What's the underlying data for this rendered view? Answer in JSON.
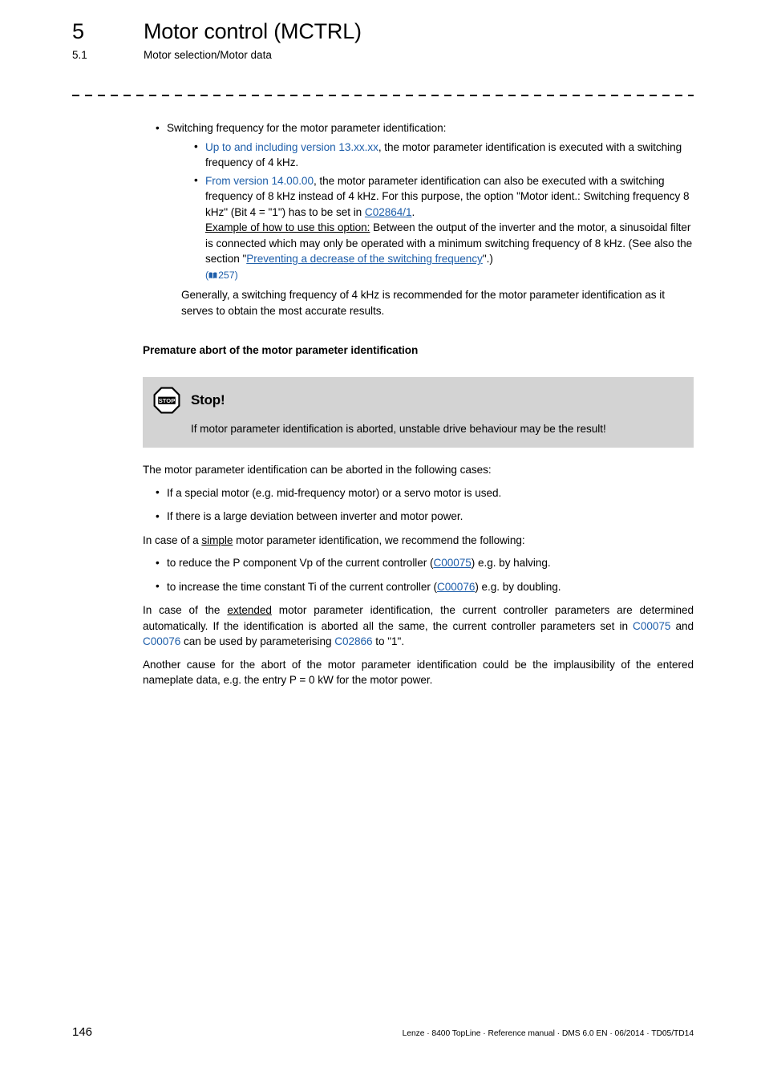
{
  "header": {
    "chapter_number": "5",
    "chapter_title": "Motor control (MCTRL)",
    "section_number": "5.1",
    "section_title": "Motor selection/Motor data"
  },
  "content": {
    "bullet_switching_frequency": "Switching frequency for the motor parameter identification:",
    "sub_bullet_1": {
      "link": "Up to and including version 13.xx.xx",
      "text": ", the motor parameter identification is executed with a switching frequency of 4 kHz."
    },
    "sub_bullet_2": {
      "link": "From version 14.00.00",
      "text_part1": ", the motor parameter identification can also be executed with a switching frequency of 8 kHz instead of 4 kHz. For this purpose, the option \"Motor ident.: Switching frequency 8 kHz\" (Bit 4 = \"1\") has to be set in ",
      "link_c02864": "C02864/1",
      "text_part2": ".",
      "example_label": "Example of how to use this option:",
      "text_part3": " Between the output of the inverter and the motor, a sinusoidal filter is connected which may only be operated with a minimum switching frequency of 8 kHz. (See also the section \"",
      "link_section": "Preventing a decrease of the switching frequency",
      "text_part4": "\".)",
      "page_ref": "257",
      "page_ref_icon": "book-icon"
    },
    "general_note": "Generally, a switching frequency of 4 kHz is recommended for the motor parameter identification as it serves to obtain the most accurate results.",
    "premature_abort_heading": "Premature abort of the motor parameter identification",
    "stop_notice": {
      "icon": "stop-sign-icon",
      "icon_label": "STOP",
      "title": "Stop!",
      "body": "If motor parameter identification is aborted, unstable drive behaviour may be the result!"
    },
    "abort_intro": "The motor parameter identification can be aborted in the following cases:",
    "abort_cases": [
      "If a special motor (e.g. mid-frequency motor) or a servo motor is used.",
      "If there is a large deviation between inverter and motor power."
    ],
    "simple_intro": {
      "text_part1": "In case of a ",
      "emphasis": "simple",
      "text_part2": " motor parameter identification, we recommend the following:"
    },
    "simple_recommendations": [
      {
        "text_part1": "to reduce the P component Vp of the current controller (",
        "link": "C00075",
        "text_part2": ") e.g. by halving."
      },
      {
        "text_part1": "to increase the time constant Ti of the current controller (",
        "link": "C00076",
        "text_part2": ") e.g. by doubling."
      }
    ],
    "extended_para": {
      "text_part1": "In case of the ",
      "emphasis": "extended",
      "text_part2": " motor parameter identification, the current controller parameters are determined automatically. If the identification is aborted all the same, the current controller parameters set in ",
      "link1": "C00075",
      "text_part3": " and ",
      "link2": "C00076",
      "text_part4": " can be used by parameterising ",
      "link3": "C02866",
      "text_part5": " to \"1\"."
    },
    "another_cause_para": "Another cause for the abort of the motor parameter identification could be the implausibility of the entered nameplate data, e.g. the entry P = 0 kW for the motor power."
  },
  "footer": {
    "page_number": "146",
    "note": "Lenze · 8400 TopLine · Reference manual · DMS 6.0 EN · 06/2014 · TD05/TD14"
  },
  "colors": {
    "link": "#1f5faa",
    "notice_background": "#d3d3d3",
    "text": "#000000"
  }
}
